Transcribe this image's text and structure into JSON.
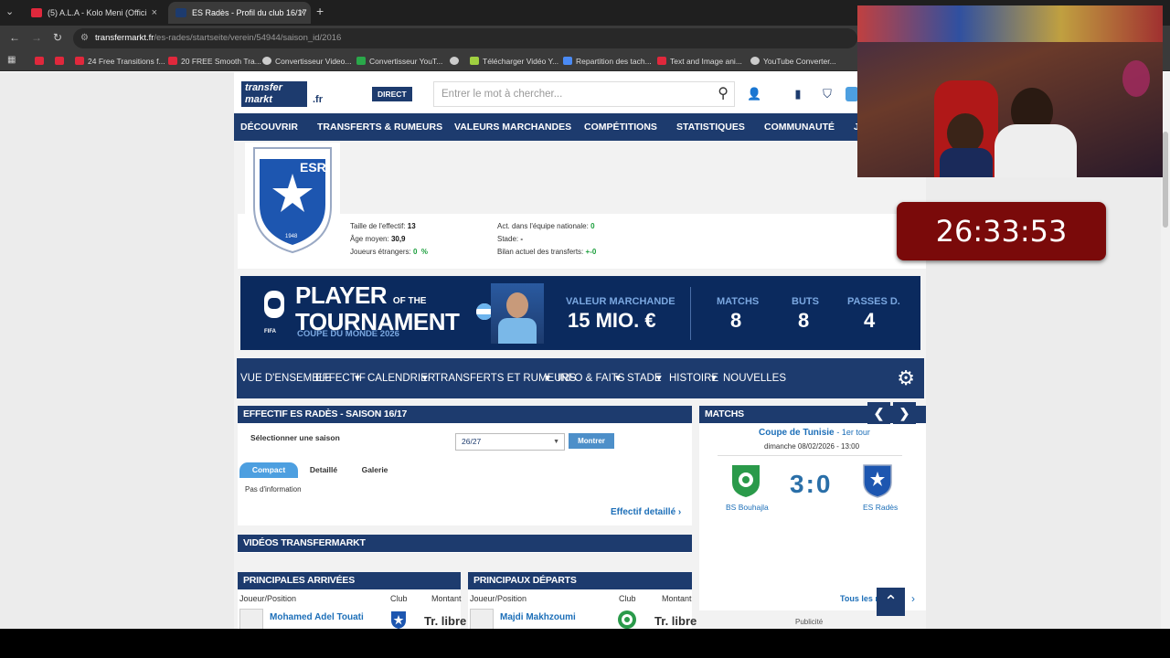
{
  "browser": {
    "tabs": [
      {
        "title": "(5) A.L.A - Kolo Meni (Offici",
        "favicon_color": "#e0283c"
      },
      {
        "title": "ES Radès - Profil du club 16/17",
        "favicon_color": "#1d3b6e"
      }
    ],
    "new_tab": "+",
    "url_host": "transfermarkt.fr",
    "url_path": "/es-rades/startseite/verein/54944/saison_id/2016",
    "bookmarks": [
      {
        "label": "",
        "color": "#e0283c"
      },
      {
        "label": "",
        "color": "#e0283c"
      },
      {
        "label": "24 Free Transitions f...",
        "color": "#e0283c"
      },
      {
        "label": "20 FREE Smooth Tra...",
        "color": "#e0283c"
      },
      {
        "label": "Convertisseur Video...",
        "color": "#cccccc"
      },
      {
        "label": "Convertisseur YouT...",
        "color": "#2aa84a"
      },
      {
        "label": "",
        "color": "#cccccc"
      },
      {
        "label": "Télécharger Vidéo Y...",
        "color": "#a0d040"
      },
      {
        "label": "Repartition des tach...",
        "color": "#4a8af4"
      },
      {
        "label": "Text and Image ani...",
        "color": "#e0283c"
      },
      {
        "label": "YouTube Converter...",
        "color": "#cccccc"
      }
    ]
  },
  "header": {
    "logo_line1": "transfer",
    "logo_line2": "markt",
    "logo_tld": ".fr",
    "direct_label": "DIRECT",
    "search_placeholder": "Entrer le mot à chercher..."
  },
  "main_nav": [
    "DÉCOUVRIR",
    "TRANSFERTS & RUMEURS",
    "VALEURS MARCHANDES",
    "COMPÉTITIONS",
    "STATISTIQUES",
    "COMMUNAUTÉ",
    "J"
  ],
  "club": {
    "crest_name": "ESR",
    "crest_year": "1948",
    "stats": [
      {
        "label": "Taille de l'effectif:",
        "value": "13"
      },
      {
        "label": "Âge moyen:",
        "value": "30,9"
      },
      {
        "label": "Joueurs étrangers:",
        "value": "0",
        "suffix": "%"
      },
      {
        "label": "Act. dans l'équipe nationale:",
        "value": "0"
      },
      {
        "label": "Stade:",
        "value": "-"
      },
      {
        "label": "Bilan actuel des transferts:",
        "value": "+-0"
      }
    ]
  },
  "ad": {
    "title_big1": "PLAYER",
    "title_small": "OF THE",
    "title_big2": "TOURNAMENT",
    "subtitle": "COUPE DU MONDE 2026",
    "fifa": "FIFA",
    "stats": [
      {
        "label": "VALEUR MARCHANDE",
        "value": "15 MIO. €"
      },
      {
        "label": "MATCHS",
        "value": "8"
      },
      {
        "label": "BUTS",
        "value": "8"
      },
      {
        "label": "PASSES D.",
        "value": "4"
      }
    ]
  },
  "sub_nav": [
    "VUE D'ENSEMBLE",
    "EFFECTIF",
    "CALENDRIER",
    "TRANSFERTS ET RUMEURS",
    "INFO & FAITS",
    "STADE",
    "HISTOIRE",
    "NOUVELLES"
  ],
  "squad": {
    "title": "EFFECTIF ES RADÈS - SAISON 16/17",
    "select_label": "Sélectionner une saison",
    "select_value": "26/27",
    "show_button": "Montrer",
    "tabs": [
      "Compact",
      "Detaillé",
      "Galerie"
    ],
    "empty": "Pas d'information",
    "detail_link": "Effectif detaillé"
  },
  "videos": {
    "title": "VIDÉOS TRANSFERMARKT"
  },
  "arrivals": {
    "title": "PRINCIPALES ARRIVÉES",
    "headers": [
      "Joueur/Position",
      "Club",
      "Montant"
    ],
    "rows": [
      {
        "name": "Mohamed Adel Touati",
        "fee": "Tr. libre"
      }
    ]
  },
  "departures": {
    "title": "PRINCIPAUX DÉPARTS",
    "headers": [
      "Joueur/Position",
      "Club",
      "Montant"
    ],
    "rows": [
      {
        "name": "Majdi Makhzoumi",
        "fee": "Tr. libre"
      }
    ]
  },
  "matches": {
    "title": "MATCHS",
    "prev": "❮",
    "next": "❯",
    "competition": "Coupe de Tunisie",
    "round": "- 1er tour",
    "date": "dimanche 08/02/2026 - 13:00",
    "home": "BS Bouhajla",
    "away": "ES Radès",
    "score": "3:0",
    "all_link": "Tous les m",
    "ad_label": "Publicité"
  },
  "overlay": {
    "timer": "26:33:53"
  }
}
